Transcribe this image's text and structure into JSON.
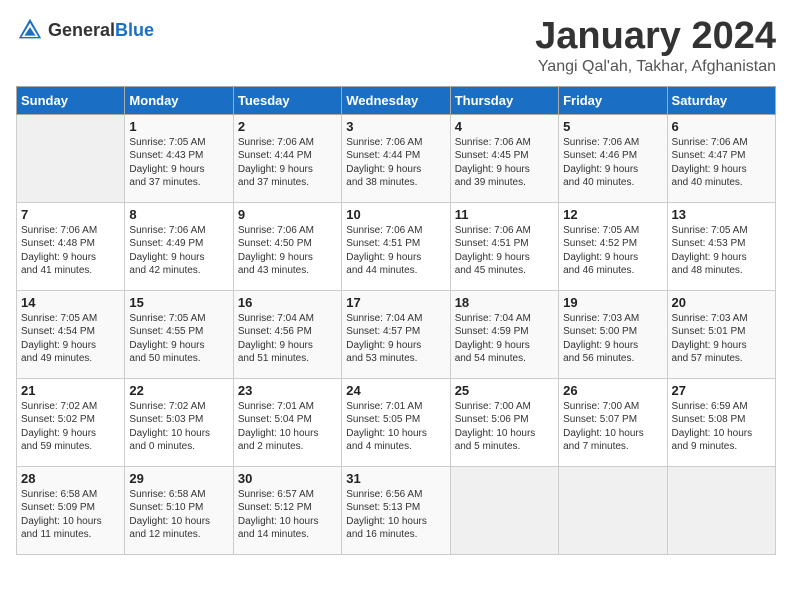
{
  "header": {
    "logo_general": "General",
    "logo_blue": "Blue",
    "title": "January 2024",
    "subtitle": "Yangi Qal'ah, Takhar, Afghanistan"
  },
  "calendar": {
    "days_of_week": [
      "Sunday",
      "Monday",
      "Tuesday",
      "Wednesday",
      "Thursday",
      "Friday",
      "Saturday"
    ],
    "weeks": [
      [
        {
          "day": "",
          "info": ""
        },
        {
          "day": "1",
          "info": "Sunrise: 7:05 AM\nSunset: 4:43 PM\nDaylight: 9 hours\nand 37 minutes."
        },
        {
          "day": "2",
          "info": "Sunrise: 7:06 AM\nSunset: 4:44 PM\nDaylight: 9 hours\nand 37 minutes."
        },
        {
          "day": "3",
          "info": "Sunrise: 7:06 AM\nSunset: 4:44 PM\nDaylight: 9 hours\nand 38 minutes."
        },
        {
          "day": "4",
          "info": "Sunrise: 7:06 AM\nSunset: 4:45 PM\nDaylight: 9 hours\nand 39 minutes."
        },
        {
          "day": "5",
          "info": "Sunrise: 7:06 AM\nSunset: 4:46 PM\nDaylight: 9 hours\nand 40 minutes."
        },
        {
          "day": "6",
          "info": "Sunrise: 7:06 AM\nSunset: 4:47 PM\nDaylight: 9 hours\nand 40 minutes."
        }
      ],
      [
        {
          "day": "7",
          "info": "Sunrise: 7:06 AM\nSunset: 4:48 PM\nDaylight: 9 hours\nand 41 minutes."
        },
        {
          "day": "8",
          "info": "Sunrise: 7:06 AM\nSunset: 4:49 PM\nDaylight: 9 hours\nand 42 minutes."
        },
        {
          "day": "9",
          "info": "Sunrise: 7:06 AM\nSunset: 4:50 PM\nDaylight: 9 hours\nand 43 minutes."
        },
        {
          "day": "10",
          "info": "Sunrise: 7:06 AM\nSunset: 4:51 PM\nDaylight: 9 hours\nand 44 minutes."
        },
        {
          "day": "11",
          "info": "Sunrise: 7:06 AM\nSunset: 4:51 PM\nDaylight: 9 hours\nand 45 minutes."
        },
        {
          "day": "12",
          "info": "Sunrise: 7:05 AM\nSunset: 4:52 PM\nDaylight: 9 hours\nand 46 minutes."
        },
        {
          "day": "13",
          "info": "Sunrise: 7:05 AM\nSunset: 4:53 PM\nDaylight: 9 hours\nand 48 minutes."
        }
      ],
      [
        {
          "day": "14",
          "info": "Sunrise: 7:05 AM\nSunset: 4:54 PM\nDaylight: 9 hours\nand 49 minutes."
        },
        {
          "day": "15",
          "info": "Sunrise: 7:05 AM\nSunset: 4:55 PM\nDaylight: 9 hours\nand 50 minutes."
        },
        {
          "day": "16",
          "info": "Sunrise: 7:04 AM\nSunset: 4:56 PM\nDaylight: 9 hours\nand 51 minutes."
        },
        {
          "day": "17",
          "info": "Sunrise: 7:04 AM\nSunset: 4:57 PM\nDaylight: 9 hours\nand 53 minutes."
        },
        {
          "day": "18",
          "info": "Sunrise: 7:04 AM\nSunset: 4:59 PM\nDaylight: 9 hours\nand 54 minutes."
        },
        {
          "day": "19",
          "info": "Sunrise: 7:03 AM\nSunset: 5:00 PM\nDaylight: 9 hours\nand 56 minutes."
        },
        {
          "day": "20",
          "info": "Sunrise: 7:03 AM\nSunset: 5:01 PM\nDaylight: 9 hours\nand 57 minutes."
        }
      ],
      [
        {
          "day": "21",
          "info": "Sunrise: 7:02 AM\nSunset: 5:02 PM\nDaylight: 9 hours\nand 59 minutes."
        },
        {
          "day": "22",
          "info": "Sunrise: 7:02 AM\nSunset: 5:03 PM\nDaylight: 10 hours\nand 0 minutes."
        },
        {
          "day": "23",
          "info": "Sunrise: 7:01 AM\nSunset: 5:04 PM\nDaylight: 10 hours\nand 2 minutes."
        },
        {
          "day": "24",
          "info": "Sunrise: 7:01 AM\nSunset: 5:05 PM\nDaylight: 10 hours\nand 4 minutes."
        },
        {
          "day": "25",
          "info": "Sunrise: 7:00 AM\nSunset: 5:06 PM\nDaylight: 10 hours\nand 5 minutes."
        },
        {
          "day": "26",
          "info": "Sunrise: 7:00 AM\nSunset: 5:07 PM\nDaylight: 10 hours\nand 7 minutes."
        },
        {
          "day": "27",
          "info": "Sunrise: 6:59 AM\nSunset: 5:08 PM\nDaylight: 10 hours\nand 9 minutes."
        }
      ],
      [
        {
          "day": "28",
          "info": "Sunrise: 6:58 AM\nSunset: 5:09 PM\nDaylight: 10 hours\nand 11 minutes."
        },
        {
          "day": "29",
          "info": "Sunrise: 6:58 AM\nSunset: 5:10 PM\nDaylight: 10 hours\nand 12 minutes."
        },
        {
          "day": "30",
          "info": "Sunrise: 6:57 AM\nSunset: 5:12 PM\nDaylight: 10 hours\nand 14 minutes."
        },
        {
          "day": "31",
          "info": "Sunrise: 6:56 AM\nSunset: 5:13 PM\nDaylight: 10 hours\nand 16 minutes."
        },
        {
          "day": "",
          "info": ""
        },
        {
          "day": "",
          "info": ""
        },
        {
          "day": "",
          "info": ""
        }
      ]
    ]
  }
}
